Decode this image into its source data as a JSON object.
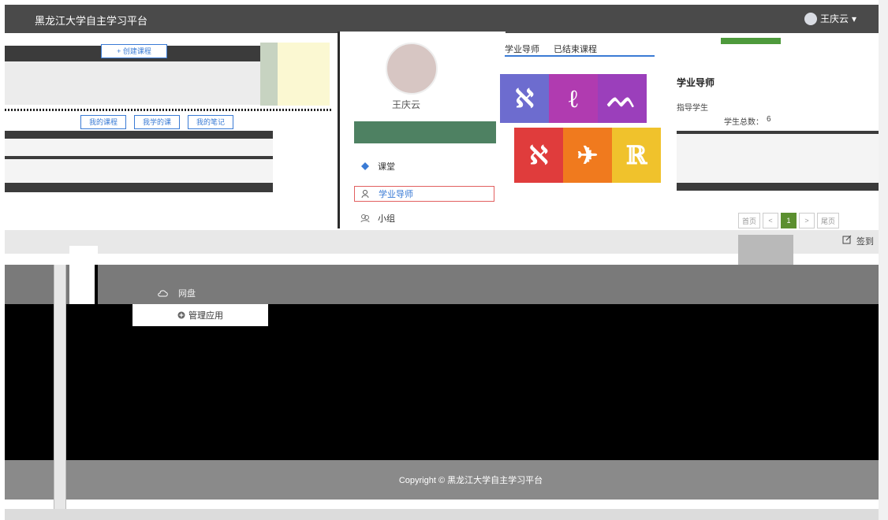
{
  "header": {
    "site_title": "黑龙江大学自主学习平台",
    "user_name": "王庆云",
    "user_caret": "▾"
  },
  "left": {
    "create_course": "+ 创建课程",
    "buttons": [
      "我的课程",
      "我学的课",
      "我的笔记"
    ]
  },
  "profile": {
    "name": "王庆云",
    "tabs": [
      "学业导师",
      "已结束课程"
    ],
    "menu": [
      {
        "label": "课堂",
        "icon": "diamond-icon"
      },
      {
        "label": "学业导师",
        "icon": "users-icon",
        "active": true
      },
      {
        "label": "小组",
        "icon": "group-icon"
      }
    ],
    "extra_menu": [
      {
        "label": "网盘",
        "icon": "cloud-icon"
      }
    ],
    "manage_apps": "管理应用"
  },
  "tiles": [
    {
      "glyph": "ℵ",
      "color": "#6d6ccf"
    },
    {
      "glyph": "ℓ",
      "color": "#b03bb0"
    },
    {
      "glyph": "ᨓ",
      "color": "#9b3fbb"
    },
    {
      "glyph": "ℵ",
      "color": "#e03c3c"
    },
    {
      "glyph": "✈",
      "color": "#f07a1e"
    },
    {
      "glyph": "ℝ",
      "color": "#f0c22c"
    }
  ],
  "info": {
    "heading": "学业导师",
    "line1": "指导学生",
    "line2": "学生总数：",
    "line2_count": "6"
  },
  "pager": {
    "first": "首页",
    "prev": "<",
    "current": "1",
    "next": ">",
    "last": "尾页"
  },
  "right_actions": {
    "sign": "签到"
  },
  "footer": {
    "copyright": "Copyright © 黑龙江大学自主学习平台"
  }
}
